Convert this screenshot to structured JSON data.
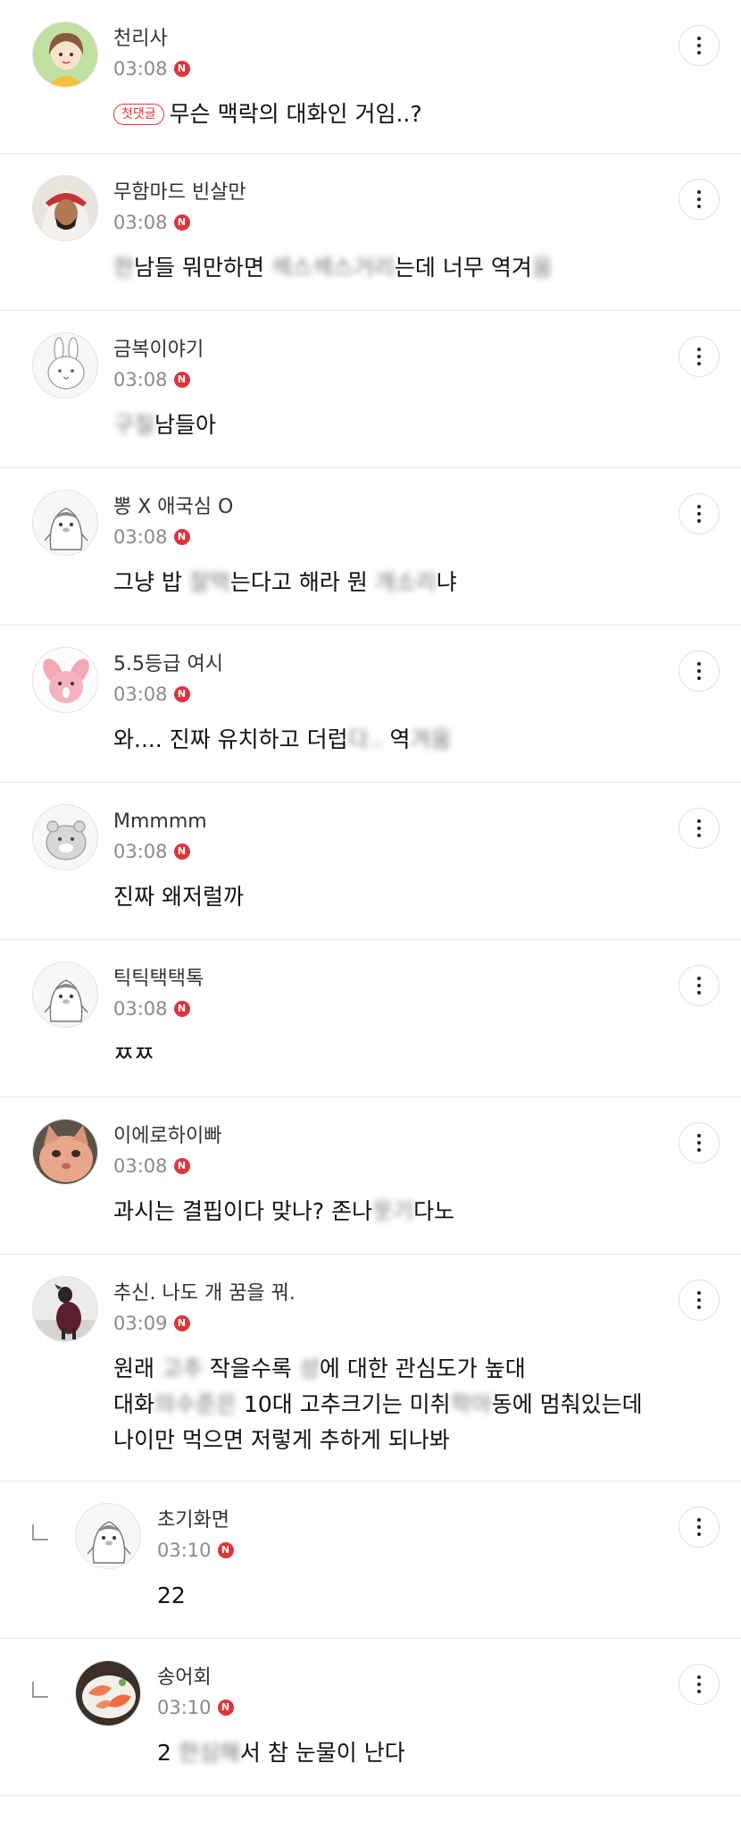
{
  "comments": [
    {
      "nick": "천리사",
      "time": "03:08",
      "badge": "N",
      "tag": "첫댓글",
      "text": "무슨 맥락의 대화인 거임..?",
      "avatar": "cartoon-girl-avatar",
      "height": 172
    },
    {
      "nick": "무함마드 빈살만",
      "time": "03:08",
      "badge": "N",
      "text": "한남들 뭐만하면 섹스섹스거리는데 너무 역겨움",
      "avatar": "photo-man-avatar",
      "height": 176
    },
    {
      "nick": "금복이야기",
      "time": "03:08",
      "badge": "N",
      "text": "구질남들아",
      "avatar": "rabbit-avatar",
      "height": 176
    },
    {
      "nick": "뽕 X 애국심 O",
      "time": "03:08",
      "badge": "N",
      "text": "그냥 밥 잘먹는다고 해라 뭔 개소리냐",
      "avatar": "penguin-avatar",
      "height": 176
    },
    {
      "nick": "5.5등급 여시",
      "time": "03:08",
      "badge": "N",
      "text": "와.... 진짜 유치하고 더럽다.. 역겨움",
      "avatar": "pink-rabbit-avatar",
      "height": 176
    },
    {
      "nick": "Mmmmm",
      "time": "03:08",
      "badge": "N",
      "text": "진짜 왜저럴까",
      "avatar": "hamster-avatar",
      "height": 176
    },
    {
      "nick": "틱틱택택톡",
      "time": "03:08",
      "badge": "N",
      "text": "ㅉㅉ",
      "avatar": "penguin-avatar",
      "height": 176
    },
    {
      "nick": "이에로하이빠",
      "time": "03:08",
      "badge": "N",
      "text": "과시는 결핍이다 맞나? 존나웃기다노",
      "avatar": "cat-photo-avatar",
      "height": 176
    },
    {
      "nick": "추신. 나도 개 꿈을 꿔.",
      "time": "03:09",
      "badge": "N",
      "text": "원래 고추 작을수록 성에 대한 관심도가 높대\n대화의수준은 10대 고추크기는 미취학아동에 멈춰있는데\n나이만 먹으면 저렇게 추하게 되나봐",
      "avatar": "dog-photo-avatar",
      "height": 254
    },
    {
      "nick": "초기화면",
      "time": "03:10",
      "badge": "N",
      "text": "22",
      "avatar": "penguin-avatar",
      "reply": true,
      "height": 176
    },
    {
      "nick": "송어회",
      "time": "03:10",
      "badge": "N",
      "text": "2 한심해서 참 눈물이 난다",
      "avatar": "salmon-photo-avatar",
      "reply": true,
      "height": 176
    }
  ]
}
